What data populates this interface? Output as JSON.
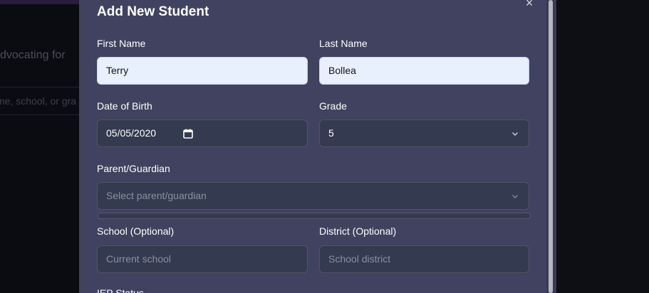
{
  "background": {
    "partial_text": "dvocating for",
    "search_placeholder_fragment": "me, school, or gra"
  },
  "modal": {
    "title": "Add New Student",
    "close_symbol": "×",
    "fields": {
      "first_name": {
        "label": "First Name",
        "value": "Terry"
      },
      "last_name": {
        "label": "Last Name",
        "value": "Bollea"
      },
      "date_of_birth": {
        "label": "Date of Birth",
        "value": "05/05/2020"
      },
      "grade": {
        "label": "Grade",
        "value": "5"
      },
      "parent_guardian": {
        "label": "Parent/Guardian",
        "placeholder": "Select parent/guardian"
      },
      "school": {
        "label": "School (Optional)",
        "placeholder": "Current school"
      },
      "district": {
        "label": "District (Optional)",
        "placeholder": "School district"
      },
      "iep_status": {
        "label": "IEP Status"
      }
    }
  },
  "colors": {
    "modal_bg": "#40425f",
    "input_light": "#e8effd",
    "input_dark": "#343a4f"
  }
}
